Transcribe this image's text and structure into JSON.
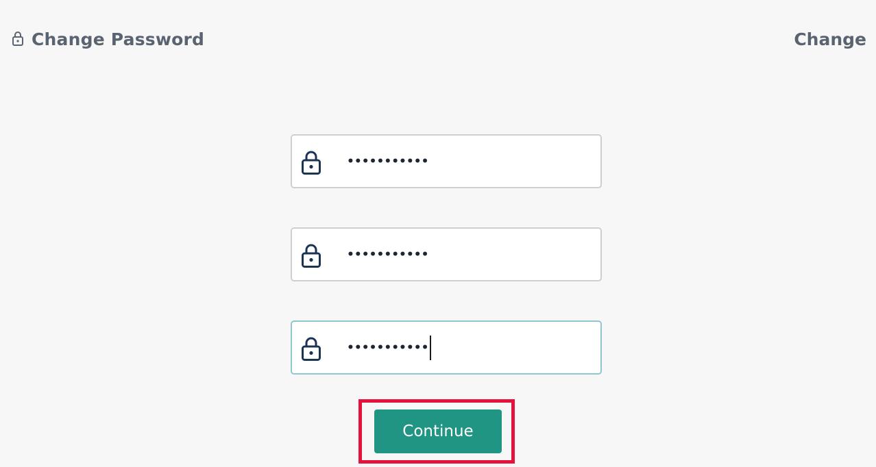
{
  "header": {
    "title": "Change Password",
    "title_icon": "lock-icon",
    "action_label": "Change"
  },
  "form": {
    "fields": [
      {
        "icon": "lock-icon",
        "masked_value": "•••••••••••",
        "focused": false
      },
      {
        "icon": "lock-icon",
        "masked_value": "•••••••••••",
        "focused": false
      },
      {
        "icon": "lock-icon",
        "masked_value": "•••••••••••",
        "focused": true
      }
    ],
    "continue_label": "Continue"
  },
  "colors": {
    "background": "#f7f7f7",
    "header_text": "#5a6470",
    "icon_navy": "#1c3454",
    "button": "#219583",
    "focus_border": "#8fc7cf",
    "highlight": "#e5133c"
  }
}
